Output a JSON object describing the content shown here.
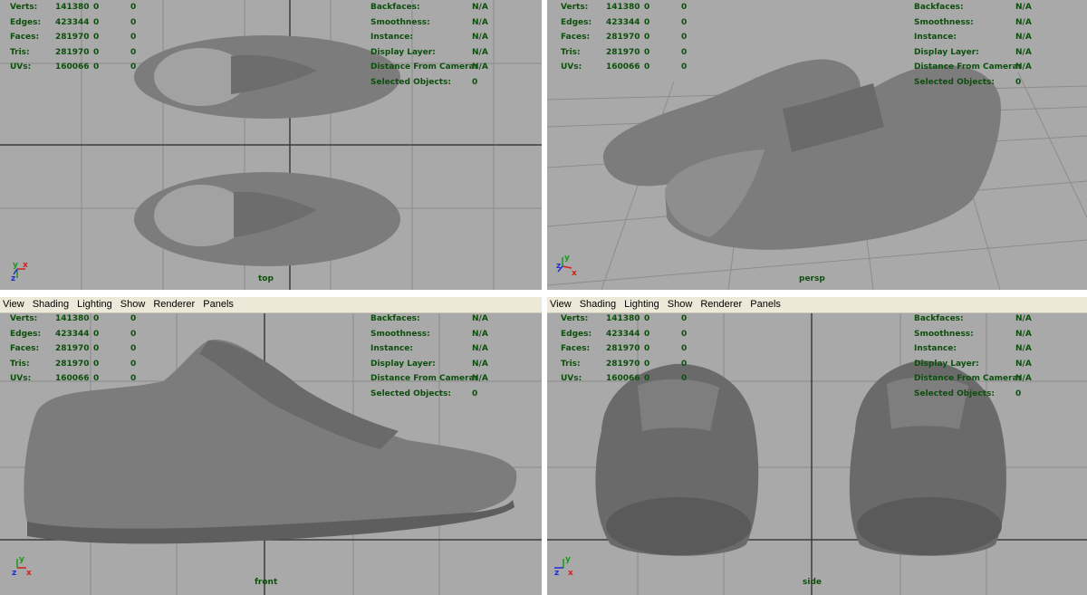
{
  "menu": [
    "View",
    "Shading",
    "Lighting",
    "Show",
    "Renderer",
    "Panels"
  ],
  "hud_labels": [
    "Verts:",
    "Edges:",
    "Faces:",
    "Tris:",
    "UVs:"
  ],
  "hud_values": [
    [
      "141380",
      "0",
      "0"
    ],
    [
      "423344",
      "0",
      "0"
    ],
    [
      "281970",
      "0",
      "0"
    ],
    [
      "281970",
      "0",
      "0"
    ],
    [
      "160066",
      "0",
      "0"
    ]
  ],
  "hud_right_labels": [
    "Backfaces:",
    "Smoothness:",
    "Instance:",
    "Display Layer:",
    "Distance From Camera:",
    "Selected Objects:"
  ],
  "hud_right_values": [
    "N/A",
    "N/A",
    "N/A",
    "N/A",
    "N/A",
    "0"
  ],
  "viewports": {
    "top": {
      "camera": "top"
    },
    "persp": {
      "camera": "persp"
    },
    "front": {
      "camera": "front"
    },
    "side": {
      "camera": "side"
    }
  },
  "axis_labels": {
    "x": "x",
    "y": "y",
    "z": "z"
  },
  "colors": {
    "viewport_bg": "#a9a9a9",
    "grid_line": "#8c8c8c",
    "grid_axis": "#3c3c3c",
    "hud_text": "#0d4f0d",
    "menu_bg": "#ece9d8",
    "shoe": "#808080"
  }
}
